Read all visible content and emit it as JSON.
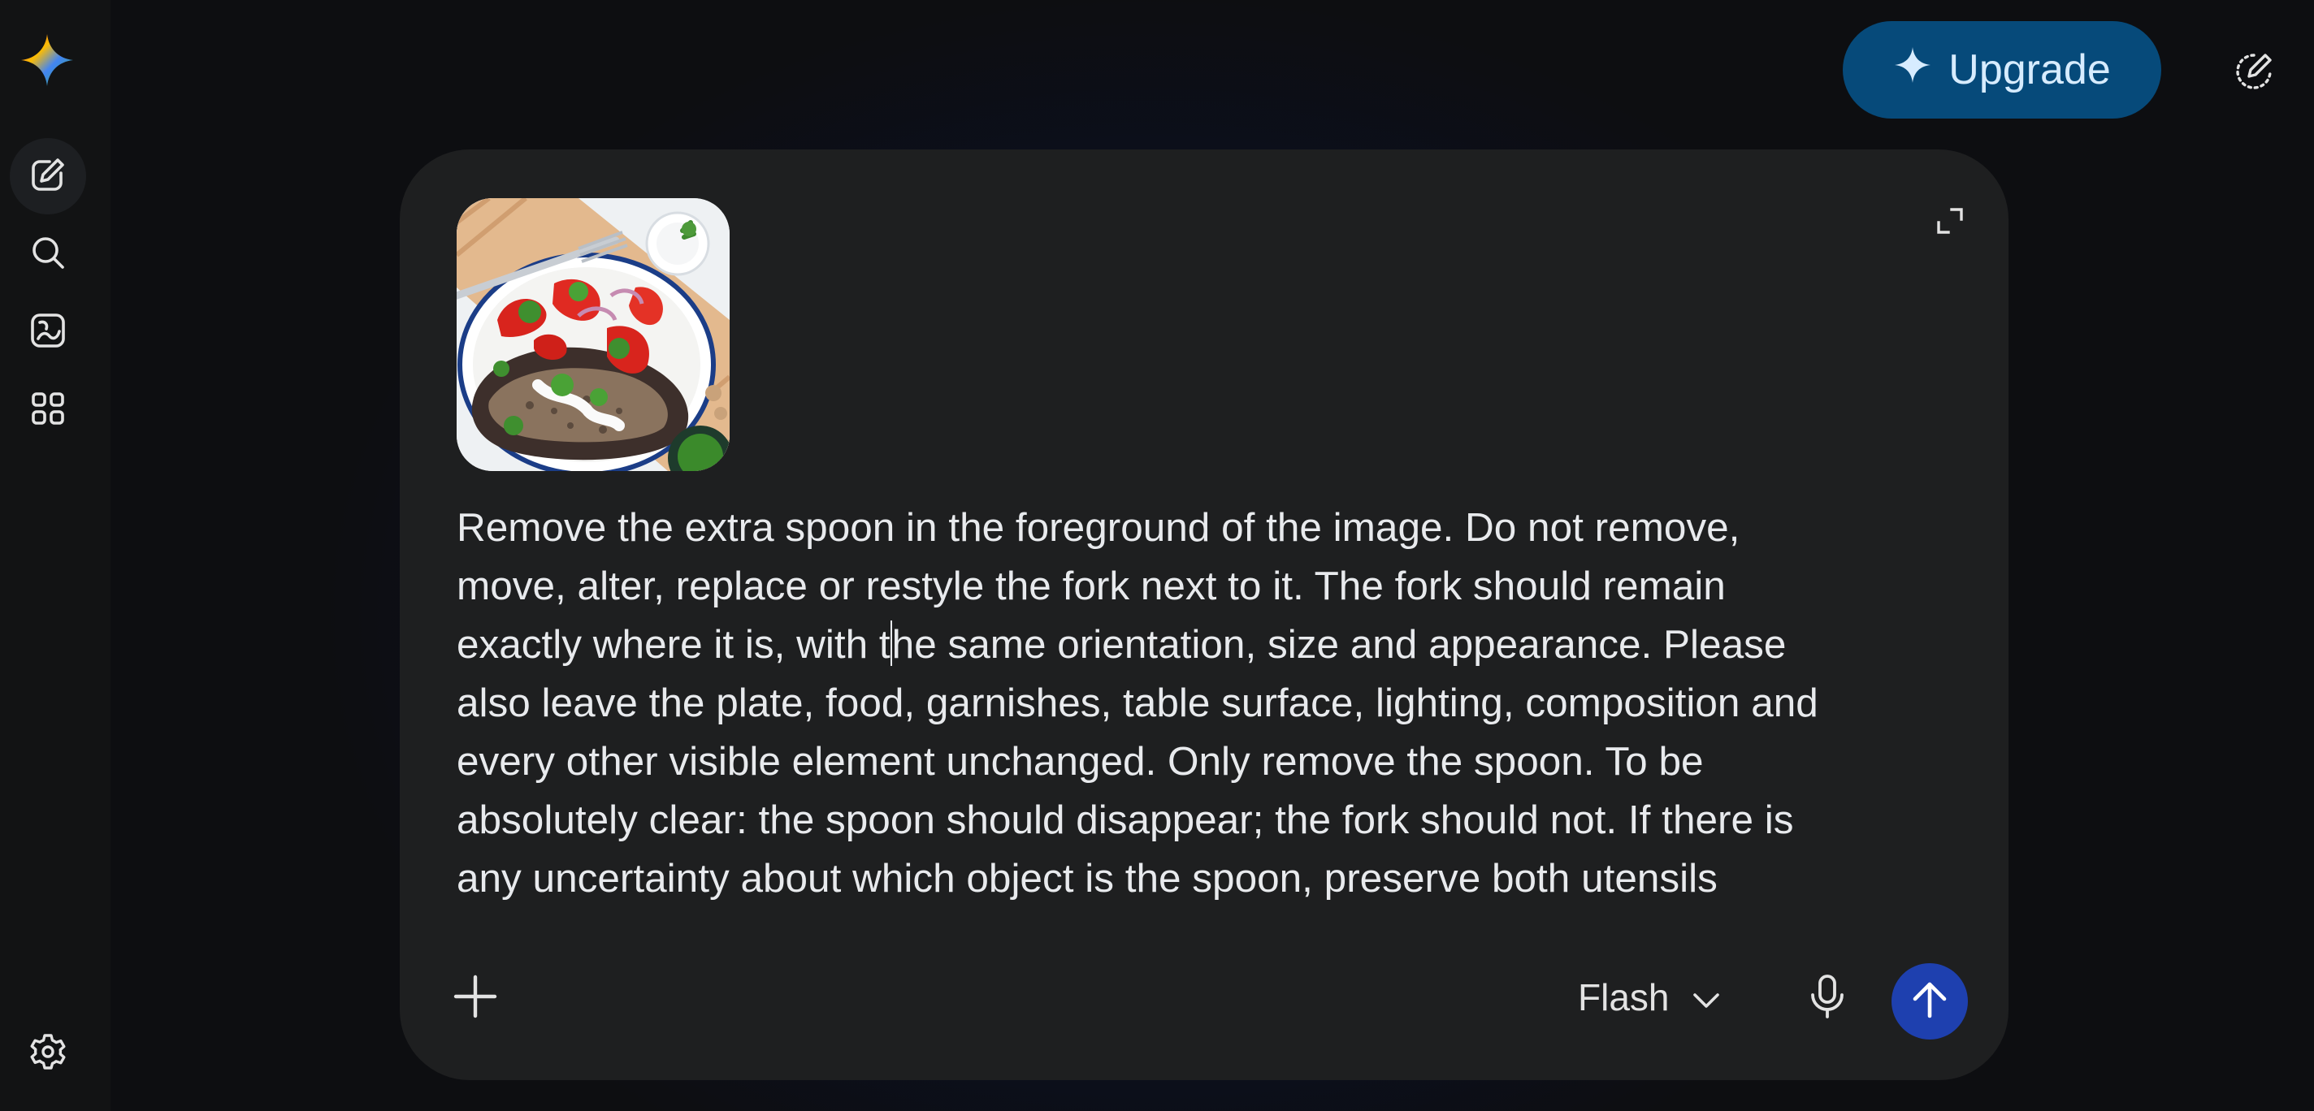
{
  "brand": {
    "logo_icon": "gemini-sparkle-icon",
    "logo_colors": [
      "#4285f4",
      "#ea4335",
      "#fbbc04",
      "#34a853"
    ]
  },
  "sidebar": {
    "items": [
      {
        "icon": "new-chat-icon",
        "active": true
      },
      {
        "icon": "search-icon",
        "active": false
      },
      {
        "icon": "image-gallery-icon",
        "active": false
      },
      {
        "icon": "apps-grid-icon",
        "active": false
      }
    ],
    "footer": {
      "icon": "gear-icon"
    }
  },
  "header": {
    "upgrade_label": "Upgrade",
    "upgrade_color": "#064a7a",
    "new_chat_icon": "edit-dotted-icon"
  },
  "composer": {
    "attachment": {
      "kind": "image-thumbnail",
      "subject": "food plate with fork and spoon"
    },
    "prompt_before_caret": "Remove the extra spoon in the foreground of the image. Do not remove, move, alter, replace or restyle the fork next to it. The fork should remain exactly where it is, with t",
    "prompt_after_caret": "he same orientation, size and appearance. Please also leave the plate, food, garnishes, table surface, lighting, composition and every other visible element unchanged. Only remove the spoon. To be absolutely clear: the spoon should disappear; the fork should not. If there is any uncertainty about which object is the spoon, preserve both utensils",
    "model_label": "Flash",
    "send_color": "#1e40af"
  }
}
